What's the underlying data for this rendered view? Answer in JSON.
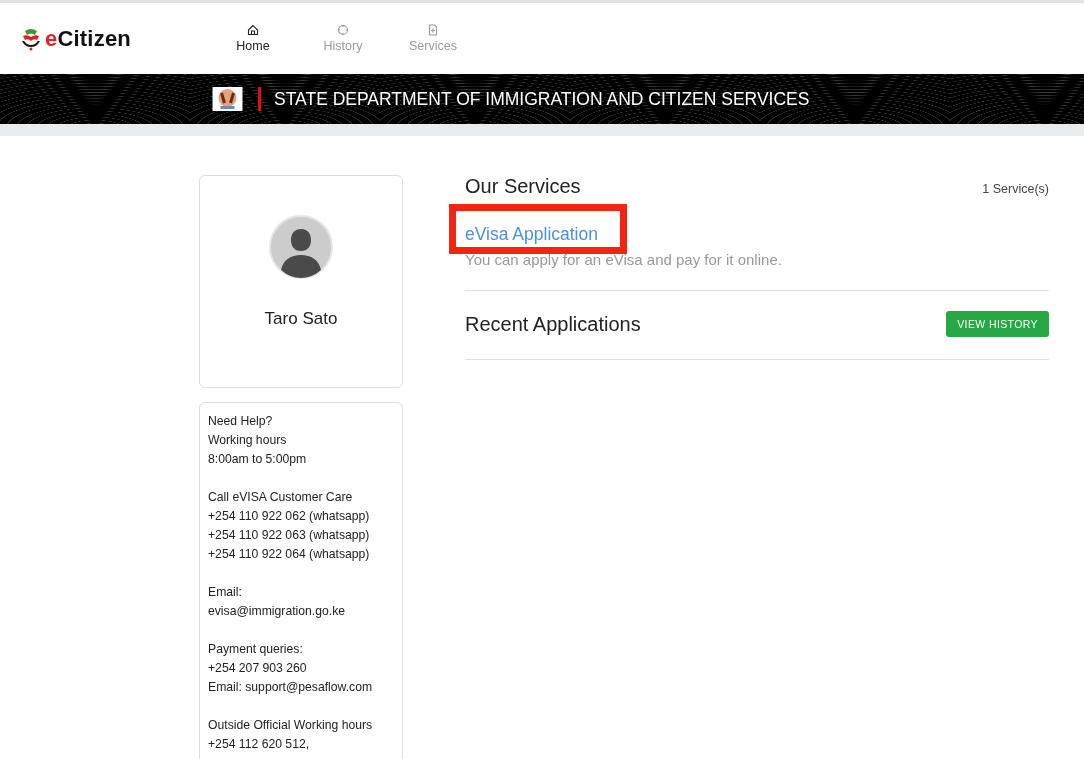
{
  "brand": {
    "name_accent": "e",
    "name": "Citizen"
  },
  "nav": [
    {
      "label": "Home",
      "selected": true
    },
    {
      "label": "History",
      "selected": false
    },
    {
      "label": "Services",
      "selected": false
    }
  ],
  "banner": {
    "title": "STATE DEPARTMENT OF IMMIGRATION AND CITIZEN SERVICES"
  },
  "profile": {
    "name": "Taro Sato"
  },
  "help": [
    [
      "Need Help?",
      "Working hours",
      "8:00am to 5:00pm"
    ],
    [
      "Call eVISA Customer Care",
      "+254 110 922 062 (whatsapp)",
      "+254 110 922 063 (whatsapp)",
      "+254 110 922 064 (whatsapp)"
    ],
    [
      "Email:",
      "evisa@immigration.go.ke"
    ],
    [
      "Payment queries:",
      "+254 207 903 260",
      "Email: support@pesaflow.com"
    ],
    [
      "Outside Official Working hours",
      "+254 112 620 512,"
    ]
  ],
  "services": {
    "title": "Our Services",
    "count": "1 Service(s)",
    "items": [
      {
        "name": "eVisa Application",
        "description": "You can apply for an eVisa and pay for it online.",
        "highlighted": true
      }
    ]
  },
  "recent": {
    "title": "Recent Applications",
    "button": "VIEW HISTORY"
  }
}
